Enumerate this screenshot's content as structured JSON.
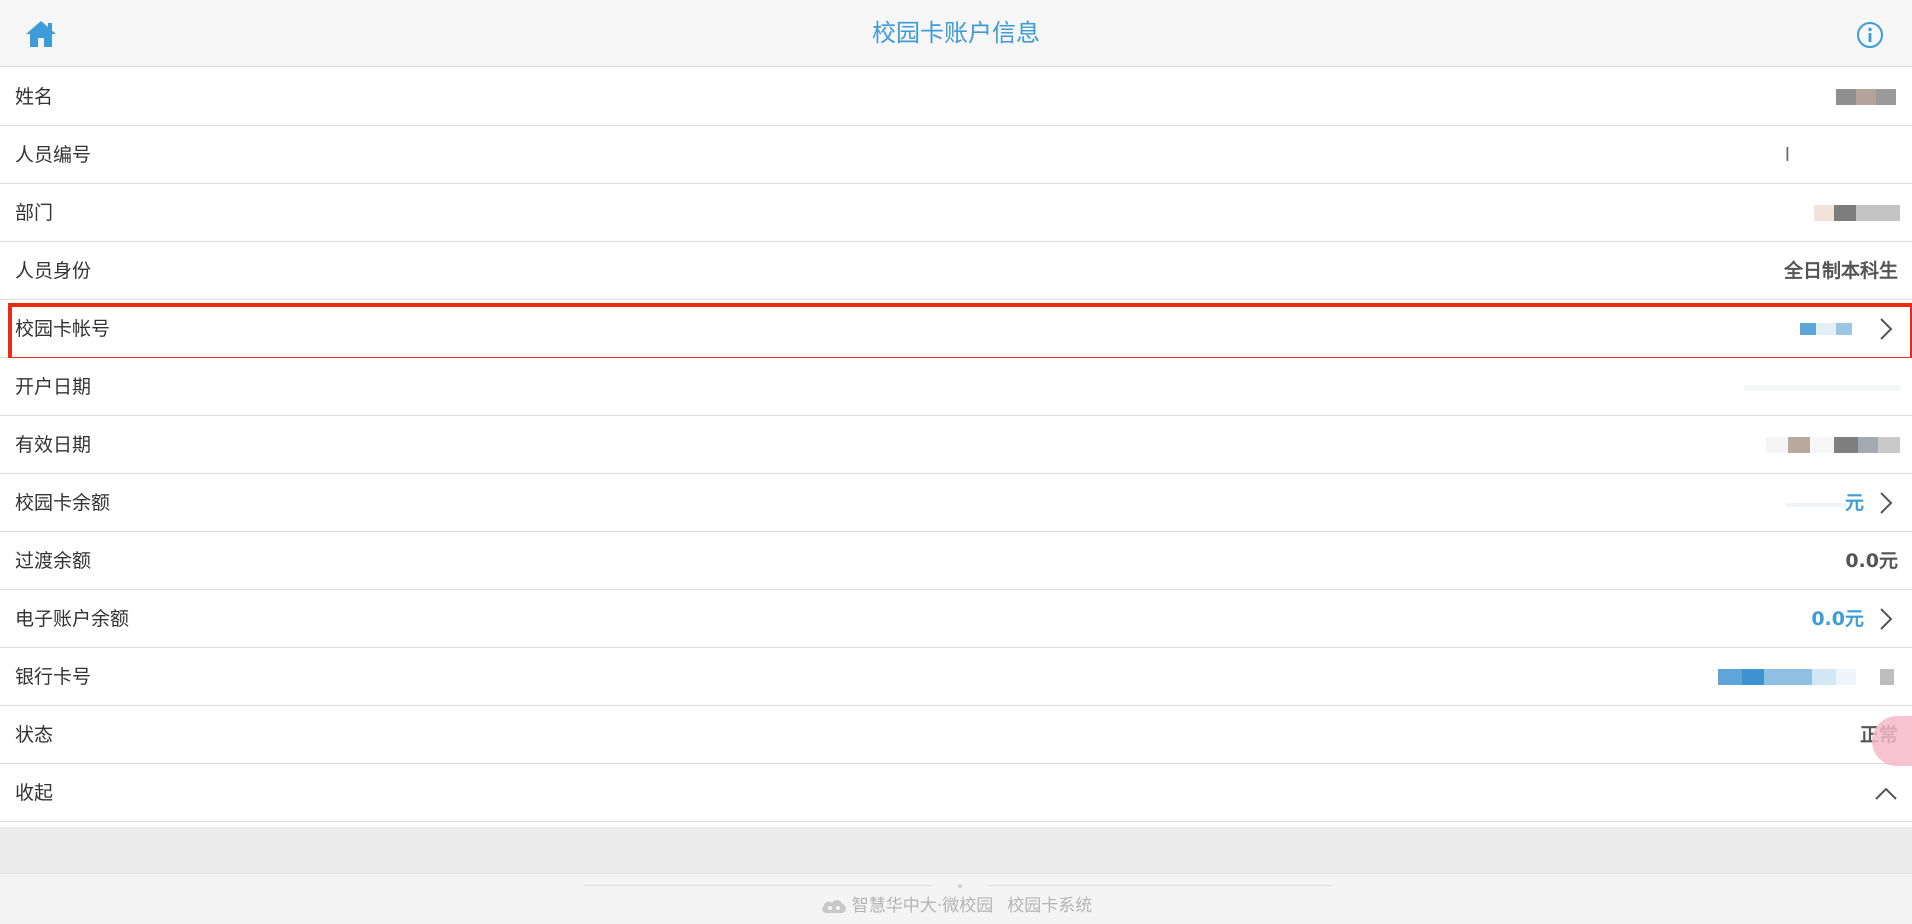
{
  "header": {
    "title": "校园卡账户信息",
    "home_icon": "home-icon",
    "info_icon": "info-icon",
    "accent_color": "#3d9bd7"
  },
  "rows": [
    {
      "label": "姓名",
      "value": ""
    },
    {
      "label": "人员编号",
      "value": "l"
    },
    {
      "label": "部门",
      "value": ""
    },
    {
      "label": "人员身份",
      "value": "全日制本科生"
    },
    {
      "label": "校园卡帐号",
      "value": ""
    },
    {
      "label": "开户日期",
      "value": ""
    },
    {
      "label": "有效日期",
      "value": ""
    },
    {
      "label": "校园卡余额",
      "value": "元"
    },
    {
      "label": "过渡余额",
      "value": "0.0元"
    },
    {
      "label": "电子账户余额",
      "value": "0.0元"
    },
    {
      "label": "银行卡号",
      "value": ""
    },
    {
      "label": "状态",
      "value": "正常"
    },
    {
      "label": "收起",
      "value": ""
    }
  ],
  "highlight_color": "#ee2a10",
  "footer": {
    "brand_name": "智慧华中大·微校园",
    "system_name": "校园卡系统",
    "logo_icon": "cloud-logo-icon"
  }
}
